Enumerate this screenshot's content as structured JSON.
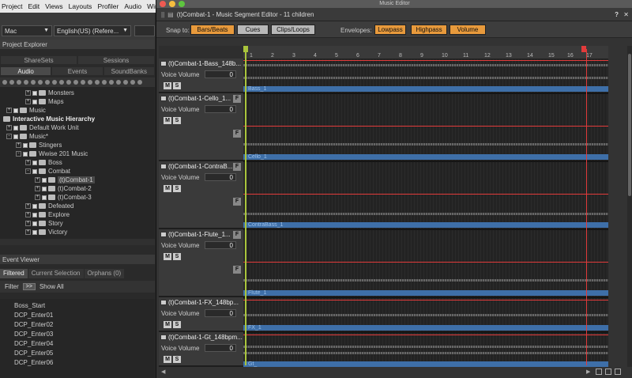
{
  "menubar": {
    "items": [
      "Project",
      "Edit",
      "Views",
      "Layouts",
      "Profiler",
      "Audio",
      "Windows"
    ]
  },
  "toolbar": {
    "platform": "Mac",
    "language": "English(US) (Refere..."
  },
  "project_explorer": {
    "title": "Project Explorer",
    "tabs_top": [
      "ShareSets",
      "Sessions"
    ],
    "tabs_bottom": [
      "Audio",
      "Events",
      "SoundBanks"
    ],
    "tree": [
      {
        "label": "Monsters"
      },
      {
        "label": "Maps"
      },
      {
        "label": "Music"
      },
      {
        "label": "Interactive Music Hierarchy"
      },
      {
        "label": "Default Work Unit"
      },
      {
        "label": "Music*"
      },
      {
        "label": "Stingers"
      },
      {
        "label": "Wwise 201 Music"
      },
      {
        "label": "Boss"
      },
      {
        "label": "Combat"
      },
      {
        "label": "(t)Combat-1"
      },
      {
        "label": "(t)Combat-2"
      },
      {
        "label": "(t)Combat-3"
      },
      {
        "label": "Defeated"
      },
      {
        "label": "Explore"
      },
      {
        "label": "Story"
      },
      {
        "label": "Victory"
      }
    ]
  },
  "event_viewer": {
    "title": "Event Viewer",
    "tabs": [
      "Filtered",
      "Current Selection",
      "Orphans (0)"
    ],
    "filter_label": "Filter",
    "filter_btn": ">>",
    "show_all": "Show All",
    "events": [
      "Boss_Start",
      "DCP_Enter01",
      "DCP_Enter02",
      "DCP_Enter03",
      "DCP_Enter04",
      "DCP_Enter05",
      "DCP_Enter06"
    ]
  },
  "music_editor": {
    "window_title": "Music Editor",
    "header_title": "(t)Combat-1 - Music Segment Editor - 11 children",
    "snap_label": "Snap to:",
    "snap_buttons": [
      "Bars/Beats",
      "Cues",
      "Clips/Loops"
    ],
    "envelopes_label": "Envelopes:",
    "envelope_buttons": [
      "Lowpass",
      "Highpass",
      "Volume"
    ],
    "ruler_numbers": [
      "1",
      "2",
      "3",
      "4",
      "5",
      "6",
      "7",
      "8",
      "9",
      "10",
      "11",
      "12",
      "13",
      "14",
      "15",
      "16",
      "17"
    ],
    "voice_volume_label": "Voice Volume",
    "mute_label": "M",
    "solo_label": "S",
    "f_label": "F",
    "tracks": [
      {
        "name": "(t)Combat-1-Bass_148b...",
        "volume": "0",
        "clip": "Bass_1"
      },
      {
        "name": "(t)Combat-1-Cello_1...",
        "volume": "0",
        "clip": "Cello_1"
      },
      {
        "name": "(t)Combat-1-ContraB...",
        "volume": "0",
        "clip": "ContraBass_1"
      },
      {
        "name": "(t)Combat-1-Flute_1...",
        "volume": "0",
        "clip": "Flute_1"
      },
      {
        "name": "(t)Combat-1-FX_148bp...",
        "volume": "0",
        "clip": "FX_1"
      },
      {
        "name": "(t)Combat-1-Gt_148bpm...",
        "volume": "0",
        "clip": "Gt_"
      }
    ]
  },
  "colors": {
    "accent_orange": "#e89a3c",
    "envelope_red": "#e23b3b",
    "clip_blue": "#3e6fa8",
    "cursor_green": "#a9c43c"
  }
}
